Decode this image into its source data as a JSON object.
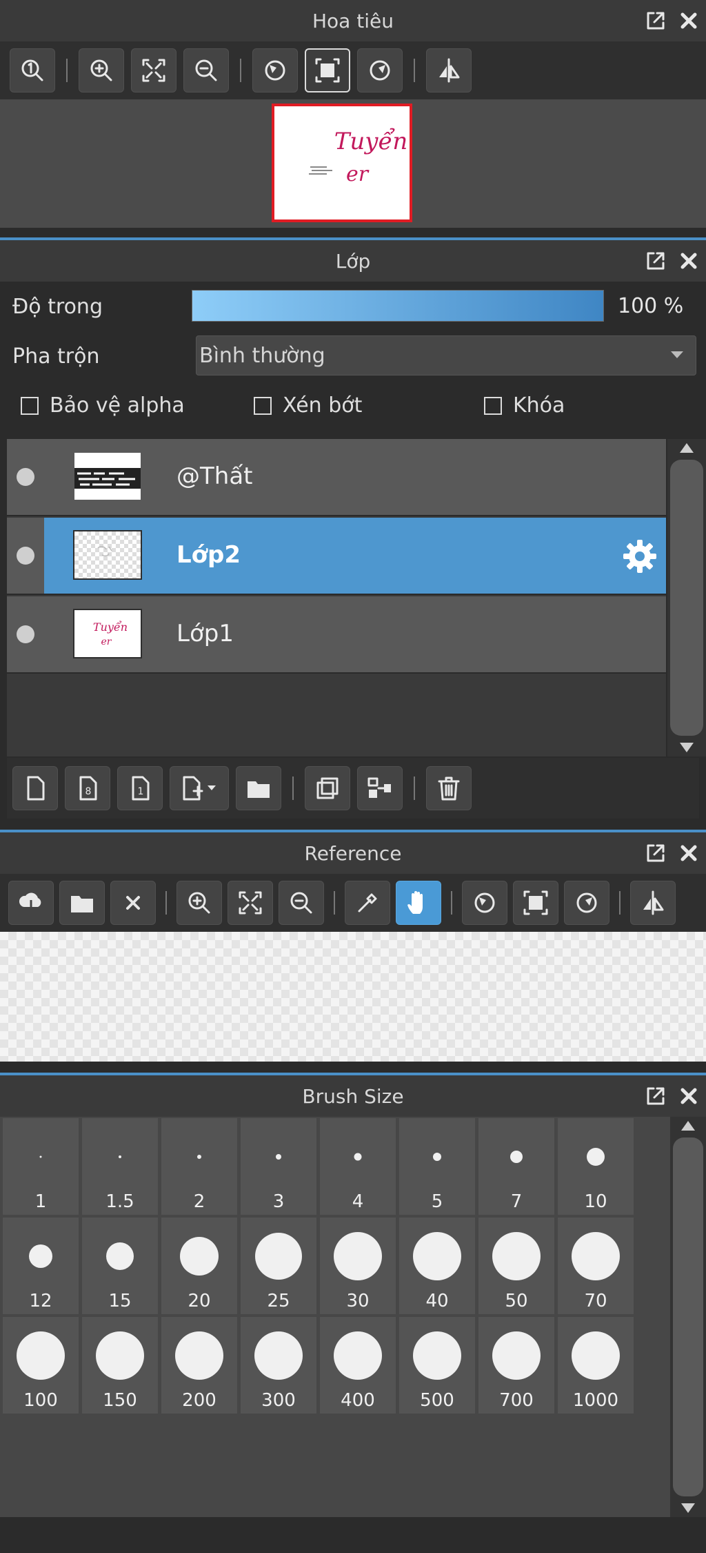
{
  "navigator": {
    "title": "Hoa tiêu",
    "thumbnail_text": "Tuyển\ner"
  },
  "layers": {
    "title": "Lớp",
    "opacity_label": "Độ trong",
    "opacity_value": "100 %",
    "opacity_fraction": 1.0,
    "blend_label": "Pha trộn",
    "blend_value": "Bình thường",
    "protect_alpha": "Bảo vệ alpha",
    "clipping": "Xén bớt",
    "lock": "Khóa",
    "list": [
      {
        "name": "@Thất",
        "selected": false
      },
      {
        "name": "Lớp2",
        "selected": true
      },
      {
        "name": "Lớp1",
        "selected": false
      }
    ]
  },
  "reference": {
    "title": "Reference"
  },
  "brush_size": {
    "title": "Brush Size",
    "sizes": [
      "1",
      "1.5",
      "2",
      "3",
      "4",
      "5",
      "7",
      "10",
      "12",
      "15",
      "20",
      "25",
      "30",
      "40",
      "50",
      "70",
      "100",
      "150",
      "200",
      "300",
      "400",
      "500",
      "700",
      "1000"
    ]
  },
  "colors": {
    "accent": "#4a9ad6",
    "panel_bg": "#2b2b2b",
    "title_bg": "#3a3a3a",
    "nav_frame": "#e01c24",
    "thumb_ink": "#c2185b"
  }
}
